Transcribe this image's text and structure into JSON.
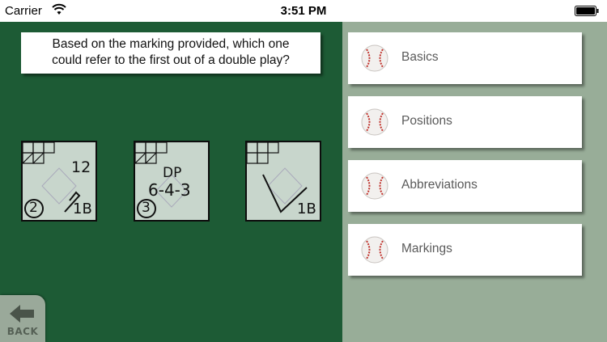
{
  "status_bar": {
    "carrier": "Carrier",
    "time": "3:51 PM"
  },
  "quiz": {
    "question_line1": "Based on the marking provided, which one",
    "question_line2": "could refer to the first out of a double play?",
    "cards": [
      {
        "top_right": "12",
        "circle_number": "2",
        "bottom_right": "1B"
      },
      {
        "line1": "DP",
        "line2": "6-4-3",
        "circle_number": "3"
      },
      {
        "bottom_right": "1B"
      }
    ]
  },
  "back_button": {
    "label": "BACK"
  },
  "menu": {
    "items": [
      {
        "label": "Basics",
        "icon": "baseball-icon"
      },
      {
        "label": "Positions",
        "icon": "baseball-icon"
      },
      {
        "label": "Abbreviations",
        "icon": "baseball-icon"
      },
      {
        "label": "Markings",
        "icon": "baseball-icon"
      }
    ]
  },
  "colors": {
    "play_area": "#1d5b35",
    "menu_panel": "#98ad98",
    "card": "#c8d6cc"
  }
}
